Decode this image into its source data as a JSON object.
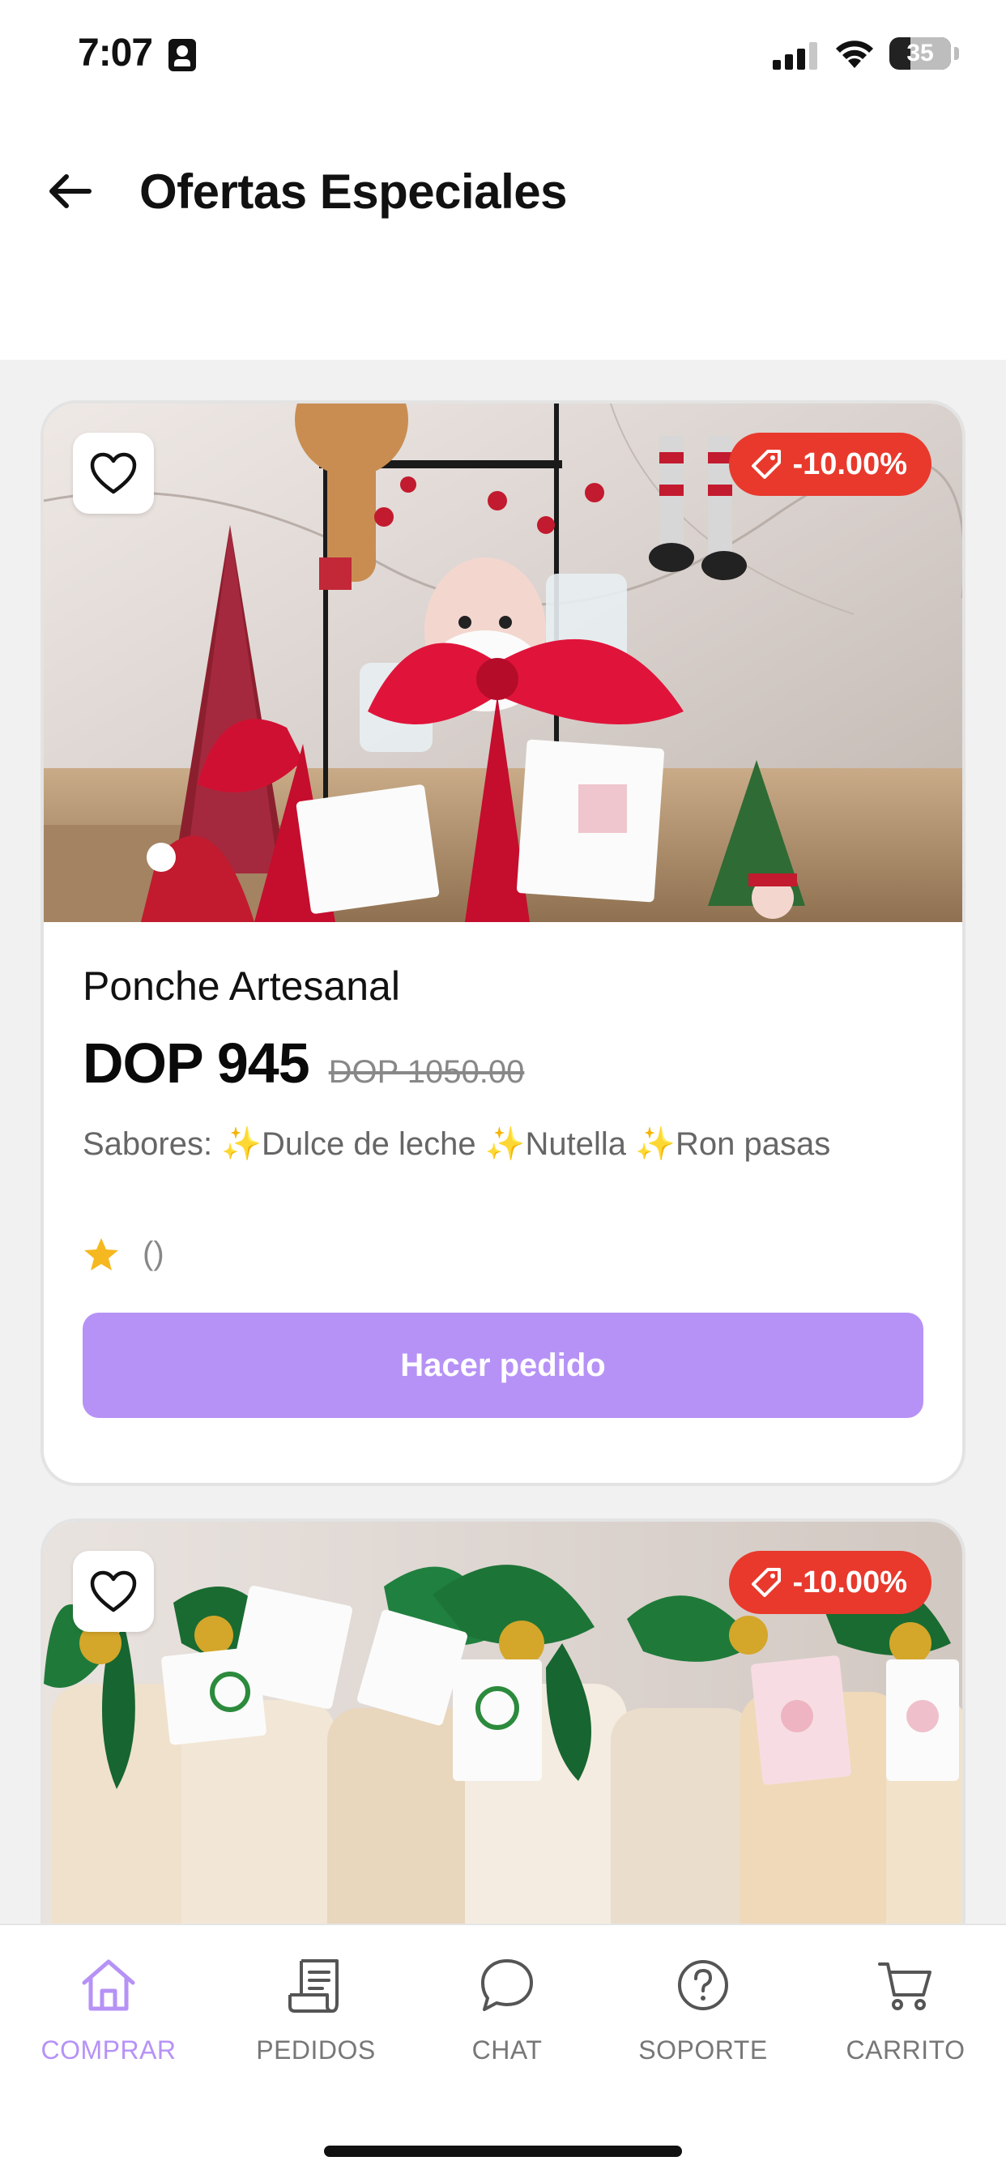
{
  "status_bar": {
    "time": "7:07",
    "battery": "35"
  },
  "header": {
    "title": "Ofertas Especiales"
  },
  "products": [
    {
      "name": "Ponche Artesanal",
      "price": "DOP 945",
      "old_price": "DOP 1050.00",
      "discount": "-10.00%",
      "description": "Sabores: ✨Dulce de leche ✨Nutella ✨Ron pasas",
      "rating_text": "()",
      "order_label": "Hacer pedido"
    },
    {
      "discount": "-10.00%"
    }
  ],
  "bottom_nav": [
    {
      "label": "COMPRAR",
      "icon": "home-icon",
      "active": true
    },
    {
      "label": "PEDIDOS",
      "icon": "receipt-icon",
      "active": false
    },
    {
      "label": "CHAT",
      "icon": "chat-bubble-icon",
      "active": false
    },
    {
      "label": "SOPORTE",
      "icon": "help-circle-icon",
      "active": false
    },
    {
      "label": "CARRITO",
      "icon": "cart-icon",
      "active": false
    }
  ],
  "colors": {
    "accent": "#b692f6",
    "discount_badge": "#e8392c",
    "star": "#f5b820"
  }
}
